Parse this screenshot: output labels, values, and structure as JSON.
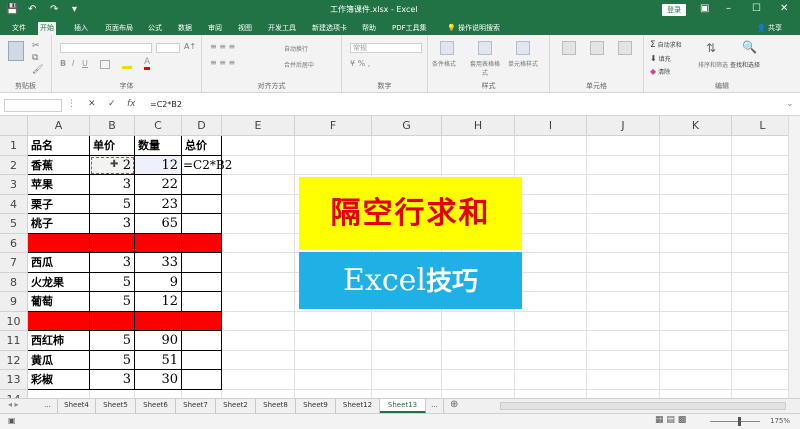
{
  "window": {
    "title": "工作簿课件.xlsx - Excel",
    "login_label": "登录",
    "qa_icons": [
      "save-icon",
      "undo-icon",
      "redo-icon",
      "more-icon"
    ]
  },
  "tabs": [
    "文件",
    "开始",
    "插入",
    "页面布局",
    "公式",
    "数据",
    "审阅",
    "视图",
    "开发工具",
    "新建选项卡",
    "帮助",
    "PDF工具集",
    "操作说明搜索"
  ],
  "active_tab": "开始",
  "share_label": "共享",
  "ribbon": {
    "clipboard_label": "剪贴板",
    "font_label": "字体",
    "align_label": "对齐方式",
    "number_label": "数字",
    "number_format": "常规",
    "styles_label": "样式",
    "cells_label": "单元格",
    "editing_label": "编辑",
    "wrap_text": "自动换行",
    "merge_center": "合并后居中",
    "cond_format": "条件格式",
    "table_format": "套用表格格式",
    "cell_style": "单元格样式",
    "autosum": "自动求和",
    "fill": "填充",
    "clear": "清除",
    "sort_filter": "排序和筛选",
    "find_select": "查找和选择"
  },
  "formula_bar": {
    "name_box": "",
    "formula": "=C2*B2"
  },
  "columns": [
    "A",
    "B",
    "C",
    "D",
    "E",
    "F",
    "G",
    "H",
    "I",
    "J",
    "K",
    "L"
  ],
  "rows": [
    "1",
    "2",
    "3",
    "4",
    "5",
    "6",
    "7",
    "8",
    "9",
    "10",
    "11",
    "12",
    "13",
    "14"
  ],
  "table": {
    "headers": [
      "品名",
      "单价",
      "数量",
      "总价"
    ],
    "data": [
      [
        "香蕉",
        "2",
        "12",
        "=C2*B2"
      ],
      [
        "苹果",
        "3",
        "22",
        ""
      ],
      [
        "栗子",
        "5",
        "23",
        ""
      ],
      [
        "桃子",
        "3",
        "65",
        ""
      ],
      [
        "",
        "",
        "",
        ""
      ],
      [
        "西瓜",
        "3",
        "33",
        ""
      ],
      [
        "火龙果",
        "5",
        "9",
        ""
      ],
      [
        "葡萄",
        "5",
        "12",
        ""
      ],
      [
        "",
        "",
        "",
        ""
      ],
      [
        "西红柿",
        "5",
        "90",
        ""
      ],
      [
        "黄瓜",
        "5",
        "51",
        ""
      ],
      [
        "彩椒",
        "3",
        "30",
        ""
      ]
    ]
  },
  "banner": {
    "line1": "隔空行求和",
    "line2_en": "Excel",
    "line2_zh": "技巧"
  },
  "sheets": [
    "...",
    "Sheet4",
    "Sheet5",
    "Sheet6",
    "Sheet7",
    "Sheet2",
    "Sheet8",
    "Sheet9",
    "Sheet12",
    "Sheet13",
    "..."
  ],
  "active_sheet": "Sheet13",
  "status": {
    "zoom": "175%"
  },
  "colors": {
    "excel_green": "#217346",
    "blank_row_fill": "#ff0000",
    "banner_yellow": "#ffff00",
    "banner_blue": "#1fb1e6",
    "banner_red_text": "#e00000"
  }
}
